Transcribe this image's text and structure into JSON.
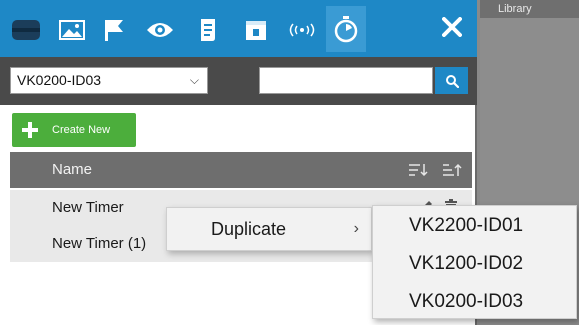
{
  "library": {
    "label": "Library"
  },
  "toolbar": {
    "icons": [
      "monitors-icon",
      "image-icon",
      "flag-icon",
      "eye-icon",
      "document-icon",
      "calendar-icon",
      "broadcast-icon",
      "timer-icon"
    ],
    "active_index": 7
  },
  "filter": {
    "device_select": "VK0200-ID03",
    "search_placeholder": ""
  },
  "create_button": {
    "label": "Create New"
  },
  "list": {
    "header": "Name",
    "rows": [
      {
        "name": "New Timer"
      },
      {
        "name": "New Timer (1)"
      }
    ]
  },
  "context_menu": {
    "item": "Duplicate",
    "arrow": "›"
  },
  "submenu": {
    "items": [
      "VK2200-ID01",
      "VK1200-ID02",
      "VK0200-ID03"
    ]
  },
  "colors": {
    "accent": "#1e88c6",
    "create": "#4cae3c",
    "header": "#6e6e6e"
  }
}
